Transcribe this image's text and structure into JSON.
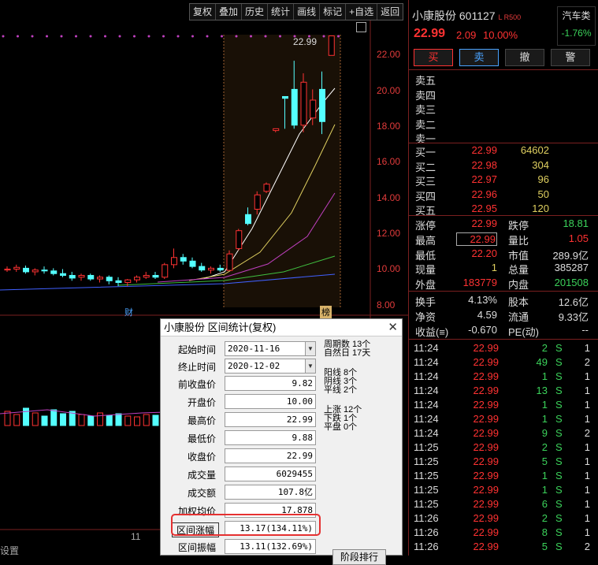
{
  "toolbar": {
    "items": [
      "复权",
      "叠加",
      "历史",
      "统计",
      "画线",
      "标记",
      "+自选",
      "返回"
    ]
  },
  "axis": {
    "ticks": [
      "22.00",
      "20.00",
      "18.00",
      "16.00",
      "14.00",
      "12.00",
      "10.00",
      "8.00"
    ],
    "last_price_label": "22.99"
  },
  "markers": {
    "m1": "财",
    "m2": "榜",
    "month": "11",
    "settings": "设置"
  },
  "chart_data": {
    "type": "candlestick",
    "y_range": [
      8.0,
      23.0
    ],
    "candles": [
      [
        9.9,
        10.1,
        9.8,
        9.95
      ],
      [
        9.95,
        10.2,
        9.8,
        10.05
      ],
      [
        10.0,
        10.15,
        9.7,
        9.8
      ],
      [
        9.8,
        10.0,
        9.6,
        9.9
      ],
      [
        9.9,
        10.1,
        9.7,
        9.85
      ],
      [
        9.85,
        10.0,
        9.6,
        9.7
      ],
      [
        9.7,
        9.95,
        9.5,
        9.6
      ],
      [
        9.6,
        9.8,
        9.3,
        9.45
      ],
      [
        9.5,
        9.7,
        9.3,
        9.6
      ],
      [
        9.6,
        9.7,
        9.3,
        9.4
      ],
      [
        9.4,
        9.6,
        9.2,
        9.5
      ],
      [
        9.5,
        9.6,
        9.1,
        9.3
      ],
      [
        9.3,
        9.5,
        9.0,
        9.2
      ],
      [
        9.2,
        9.4,
        9.0,
        9.35
      ],
      [
        9.35,
        9.6,
        9.2,
        9.5
      ],
      [
        9.5,
        9.8,
        9.4,
        9.6
      ],
      [
        9.6,
        9.8,
        9.4,
        9.5
      ],
      [
        9.5,
        10.3,
        9.4,
        10.2
      ],
      [
        10.2,
        11.1,
        10.0,
        10.6
      ],
      [
        10.6,
        10.8,
        10.2,
        10.4
      ],
      [
        10.4,
        10.6,
        10.0,
        10.1
      ],
      [
        10.1,
        10.3,
        9.8,
        9.9
      ],
      [
        9.9,
        10.1,
        9.7,
        10.0
      ],
      [
        10.0,
        10.2,
        9.8,
        9.9
      ],
      [
        9.88,
        11.0,
        9.88,
        10.8
      ],
      [
        11.1,
        12.2,
        11.0,
        12.1
      ],
      [
        13.0,
        13.4,
        12.4,
        12.5
      ],
      [
        13.3,
        14.3,
        13.0,
        14.1
      ],
      [
        14.3,
        14.8,
        14.2,
        14.7
      ],
      [
        17.7,
        17.8,
        17.6,
        17.8
      ],
      [
        19.6,
        19.6,
        17.8,
        19.5
      ],
      [
        20.0,
        21.6,
        17.8,
        18.0
      ],
      [
        18.0,
        20.9,
        17.6,
        20.4
      ],
      [
        18.4,
        20.0,
        18.0,
        19.4
      ],
      [
        20.0,
        21.0,
        17.5,
        18.2
      ],
      [
        21.9,
        22.99,
        21.9,
        22.99
      ]
    ]
  },
  "stock": {
    "name_code": "小康股份 601127",
    "flags": "L R500",
    "sector": "汽车类",
    "sector_chg": "-1.76%",
    "price": "22.99",
    "chg": "2.09",
    "pct": "10.00%"
  },
  "buttons": {
    "buy": "买",
    "sell": "卖",
    "cancel": "撤",
    "alert": "警"
  },
  "asks": [
    {
      "label": "卖五"
    },
    {
      "label": "卖四"
    },
    {
      "label": "卖三"
    },
    {
      "label": "卖二"
    },
    {
      "label": "卖一"
    }
  ],
  "bids": [
    {
      "label": "买一",
      "price": "22.99",
      "vol": "64602"
    },
    {
      "label": "买二",
      "price": "22.98",
      "vol": "304"
    },
    {
      "label": "买三",
      "price": "22.97",
      "vol": "96"
    },
    {
      "label": "买四",
      "price": "22.96",
      "vol": "50"
    },
    {
      "label": "买五",
      "price": "22.95",
      "vol": "120"
    }
  ],
  "stats": [
    {
      "l1": "涨停",
      "v1": "22.99",
      "l2": "跌停",
      "v2": "18.81"
    },
    {
      "l1": "最高",
      "v1": "22.99",
      "l2": "量比",
      "v2": "1.05"
    },
    {
      "l1": "最低",
      "v1": "22.20",
      "l2": "市值",
      "v2": "289.9亿"
    },
    {
      "l1": "现量",
      "v1": "1",
      "l2": "总量",
      "v2": "385287"
    },
    {
      "l1": "外盘",
      "v1": "183779",
      "l2": "内盘",
      "v2": "201508"
    }
  ],
  "stats2": [
    {
      "l1": "换手",
      "v1": "4.13%",
      "l2": "股本",
      "v2": "12.6亿"
    },
    {
      "l1": "净资",
      "v1": "4.59",
      "l2": "流通",
      "v2": "9.33亿"
    },
    {
      "l1": "收益(≡)",
      "v1": "-0.670",
      "l2": "PE(动)",
      "v2": "--"
    }
  ],
  "ticks": [
    {
      "t": "11:24",
      "p": "22.99",
      "v": "2",
      "s": "S",
      "n": "1"
    },
    {
      "t": "11:24",
      "p": "22.99",
      "v": "49",
      "s": "S",
      "n": "2"
    },
    {
      "t": "11:24",
      "p": "22.99",
      "v": "1",
      "s": "S",
      "n": "1"
    },
    {
      "t": "11:24",
      "p": "22.99",
      "v": "13",
      "s": "S",
      "n": "1"
    },
    {
      "t": "11:24",
      "p": "22.99",
      "v": "1",
      "s": "S",
      "n": "1"
    },
    {
      "t": "11:24",
      "p": "22.99",
      "v": "1",
      "s": "S",
      "n": "1"
    },
    {
      "t": "11:24",
      "p": "22.99",
      "v": "9",
      "s": "S",
      "n": "2"
    },
    {
      "t": "11:25",
      "p": "22.99",
      "v": "2",
      "s": "S",
      "n": "1"
    },
    {
      "t": "11:25",
      "p": "22.99",
      "v": "5",
      "s": "S",
      "n": "1"
    },
    {
      "t": "11:25",
      "p": "22.99",
      "v": "1",
      "s": "S",
      "n": "1"
    },
    {
      "t": "11:25",
      "p": "22.99",
      "v": "1",
      "s": "S",
      "n": "1"
    },
    {
      "t": "11:25",
      "p": "22.99",
      "v": "6",
      "s": "S",
      "n": "1"
    },
    {
      "t": "11:26",
      "p": "22.99",
      "v": "2",
      "s": "S",
      "n": "1"
    },
    {
      "t": "11:26",
      "p": "22.99",
      "v": "8",
      "s": "S",
      "n": "1"
    },
    {
      "t": "11:26",
      "p": "22.99",
      "v": "5",
      "s": "S",
      "n": "2"
    }
  ],
  "dialog": {
    "title": "小康股份 区间统计(复权)",
    "start_label": "起始时间",
    "start": "2020-11-16",
    "end_label": "终止时间",
    "end": "2020-12-02",
    "fields": [
      {
        "label": "前收盘价",
        "value": "9.82"
      },
      {
        "label": "开盘价",
        "value": "10.00"
      },
      {
        "label": "最高价",
        "value": "22.99"
      },
      {
        "label": "最低价",
        "value": "9.88"
      },
      {
        "label": "收盘价",
        "value": "22.99"
      },
      {
        "label": "成交量",
        "value": "6029455"
      },
      {
        "label": "成交额",
        "value": "107.8亿"
      },
      {
        "label": "加权均价",
        "value": "17.878"
      },
      {
        "label": "区间涨幅",
        "value": "13.17(134.11%)"
      },
      {
        "label": "区间振幅",
        "value": "13.11(132.69%)"
      }
    ],
    "periods": "周期数 13个",
    "days": "自然日 17天",
    "yang": "阳线 8个",
    "yin": "阴线 3个",
    "flat": "平线 2个",
    "up": "上涨 12个",
    "down": "下跌 1个",
    "flat2": "平盘 0个",
    "stage_btn": "阶段排行"
  }
}
